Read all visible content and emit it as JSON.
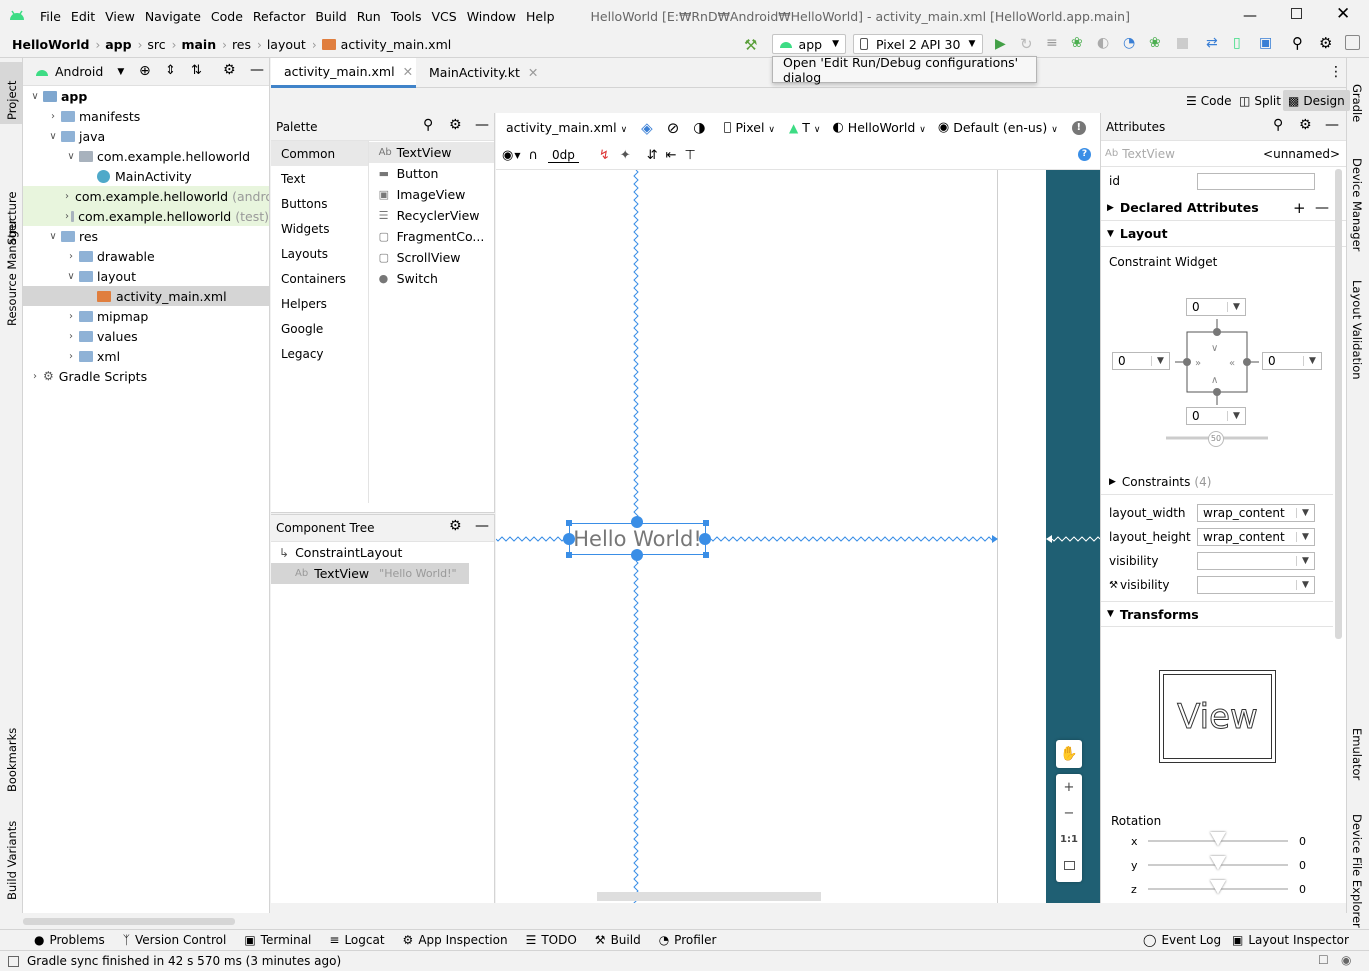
{
  "window_title": "HelloWorld [E:₩RnD₩Android₩HelloWorld] - activity_main.xml [HelloWorld.app.main]",
  "menu": [
    "File",
    "Edit",
    "View",
    "Navigate",
    "Code",
    "Refactor",
    "Build",
    "Run",
    "Tools",
    "VCS",
    "Window",
    "Help"
  ],
  "breadcrumb": [
    "HelloWorld",
    "app",
    "src",
    "main",
    "res",
    "layout",
    "activity_main.xml"
  ],
  "toolbar": {
    "run_config": "app",
    "device": "Pixel 2 API 30"
  },
  "tooltip": "Open 'Edit Run/Debug configurations' dialog",
  "left_dock": [
    "Project",
    "Structure",
    "Resource Manager",
    "Bookmarks",
    "Build Variants"
  ],
  "right_dock": [
    "Gradle",
    "Device Manager",
    "Layout Validation",
    "Emulator",
    "Device File Explorer"
  ],
  "project": {
    "view_mode": "Android",
    "tree": [
      {
        "label": "app",
        "depth": 0,
        "expanded": true,
        "icon": "module-icon"
      },
      {
        "label": "manifests",
        "depth": 1,
        "expanded": false,
        "icon": "folder-icon"
      },
      {
        "label": "java",
        "depth": 1,
        "expanded": true,
        "icon": "folder-icon"
      },
      {
        "label": "com.example.helloworld",
        "depth": 2,
        "expanded": true,
        "icon": "package-icon"
      },
      {
        "label": "MainActivity",
        "depth": 3,
        "expanded": null,
        "icon": "kotlin-class-icon"
      },
      {
        "label": "com.example.helloworld",
        "suffix": "(andro",
        "depth": 2,
        "expanded": false,
        "icon": "package-icon",
        "highlight": true
      },
      {
        "label": "com.example.helloworld",
        "suffix": "(test)",
        "depth": 2,
        "expanded": false,
        "icon": "package-icon",
        "highlight": true
      },
      {
        "label": "res",
        "depth": 1,
        "expanded": true,
        "icon": "res-folder-icon"
      },
      {
        "label": "drawable",
        "depth": 2,
        "expanded": false,
        "icon": "folder-icon"
      },
      {
        "label": "layout",
        "depth": 2,
        "expanded": true,
        "icon": "folder-icon"
      },
      {
        "label": "activity_main.xml",
        "depth": 3,
        "expanded": null,
        "icon": "xml-file-icon",
        "selected": true
      },
      {
        "label": "mipmap",
        "depth": 2,
        "expanded": false,
        "icon": "folder-icon"
      },
      {
        "label": "values",
        "depth": 2,
        "expanded": false,
        "icon": "folder-icon"
      },
      {
        "label": "xml",
        "depth": 2,
        "expanded": false,
        "icon": "folder-icon"
      },
      {
        "label": "Gradle Scripts",
        "depth": 0,
        "expanded": false,
        "icon": "gradle-icon"
      }
    ]
  },
  "editor_tabs": [
    {
      "label": "activity_main.xml",
      "active": true
    },
    {
      "label": "MainActivity.kt",
      "active": false
    }
  ],
  "modes": [
    "Code",
    "Split",
    "Design"
  ],
  "palette": {
    "title": "Palette",
    "categories": [
      "Common",
      "Text",
      "Buttons",
      "Widgets",
      "Layouts",
      "Containers",
      "Helpers",
      "Google",
      "Legacy"
    ],
    "widgets": [
      "TextView",
      "Button",
      "ImageView",
      "RecyclerView",
      "FragmentCo...",
      "ScrollView",
      "Switch"
    ]
  },
  "component_tree": {
    "title": "Component Tree",
    "root": "ConstraintLayout",
    "child": "TextView",
    "child_text": "\"Hello World!\""
  },
  "design_toolbar": {
    "file": "activity_main.xml",
    "device": "Pixel",
    "api": "T",
    "theme": "HelloWorld",
    "locale": "Default (en-us)",
    "margin": "0dp"
  },
  "canvas": {
    "text": "Hello World!"
  },
  "attributes": {
    "title": "Attributes",
    "widget_type": "TextView",
    "widget_name": "<unnamed>",
    "id_label": "id",
    "declared": "Declared Attributes",
    "layout": "Layout",
    "constraint_widget": "Constraint Widget",
    "margins": {
      "top": "0",
      "left": "0",
      "right": "0",
      "bottom": "0"
    },
    "bias": "50",
    "constraints": "Constraints",
    "constraints_count": "(4)",
    "rows": [
      {
        "label": "layout_width",
        "value": "wrap_content"
      },
      {
        "label": "layout_height",
        "value": "wrap_content"
      },
      {
        "label": "visibility",
        "value": ""
      },
      {
        "label": "visibility",
        "value": ""
      }
    ],
    "transforms": "Transforms",
    "view_preview": "View",
    "rotation": "Rotation",
    "axes": [
      {
        "axis": "x",
        "value": "0"
      },
      {
        "axis": "y",
        "value": "0"
      },
      {
        "axis": "z",
        "value": "0"
      }
    ]
  },
  "bottom_tools": [
    "Problems",
    "Version Control",
    "Terminal",
    "Logcat",
    "App Inspection",
    "TODO",
    "Build",
    "Profiler"
  ],
  "bottom_right_tools": [
    "Event Log",
    "Layout Inspector"
  ],
  "status": "Gradle sync finished in 42 s 570 ms (3 minutes ago)"
}
